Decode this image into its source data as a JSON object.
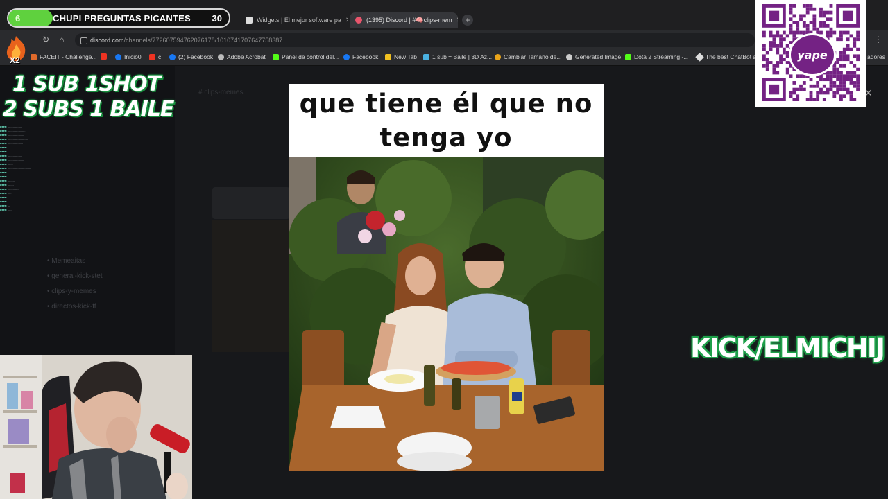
{
  "goal": {
    "current": "6",
    "title": "CHUPI PREGUNTAS PICANTES",
    "max": "30",
    "progress": 0.2
  },
  "browser": {
    "tabs": [
      {
        "title": "Widgets | El mejor software pa",
        "active": false
      },
      {
        "title": "(1395) Discord | #🧠clips-mem",
        "active": true
      }
    ],
    "url_domain": "discord.com",
    "url_path": "/channels/772607594762076178/1010741707647758387",
    "bookmarks": [
      "FACEIT - Challenge...",
      "Inicio0",
      "c",
      "(2) Facebook",
      "Adobe Acrobat",
      "Panel de control del...",
      "Facebook",
      "New Tab",
      "1 sub = Baile | 3D Az...",
      "Cambiar Tamaño de...",
      "Generated Image",
      "Dota 2 Streaming -...",
      "The best ChatBot an",
      "adores"
    ]
  },
  "overlay": {
    "promo_line1": "1 SUB 1SHOT",
    "promo_line2": "2 SUBS 1 BAILE",
    "kick": "KICK/ELMICHIJ",
    "multiplier": "X2",
    "qr_logo": "yape"
  },
  "discord_background": {
    "channel": "clips-memes",
    "channels": [
      "Memeaitas",
      "general-kick-stet",
      "clips-y-memes",
      "directos-kick-ff"
    ],
    "ghost_caption": "que tiene él que no tenga yo"
  },
  "meme": {
    "caption_line1": "que tiene él que no",
    "caption_line2": "tenga yo"
  },
  "colors": {
    "brand_green": "#1ea04a",
    "goal_fill": "#5fd13e",
    "yape_purple": "#742284"
  }
}
